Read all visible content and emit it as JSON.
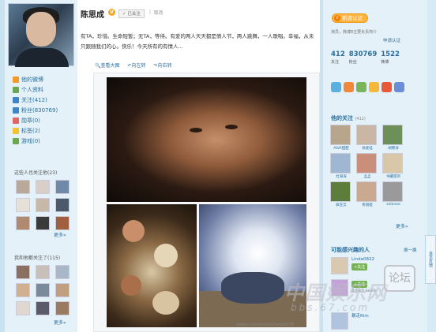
{
  "profile": {
    "name": "陈思成",
    "followed_label": "已关注",
    "separator": "|",
    "cancel_label": "取消"
  },
  "post": {
    "text": "有TA，珍惜。生命短暂；无TA，等待。有爱的两人天天都是情人节，两人跳舞，一人歌唱。幸福，从未只跟随我们的心。快乐！今天所有的有情人..."
  },
  "post_tools": [
    "查看大图",
    "向左转",
    "向右转"
  ],
  "photo_credit": "weibo.com/chensichong1078",
  "watermark": {
    "main": "中国娱乐网",
    "sub": "bbs.67.com",
    "box": "论坛"
  },
  "left_nav": [
    {
      "label": "他的微博",
      "icon": "home-icon",
      "color": "#f39a2b"
    },
    {
      "label": "个人资料",
      "icon": "profile-icon",
      "color": "#6aa84f"
    },
    {
      "label": "关注(412)",
      "icon": "follow-icon",
      "color": "#3d85c6"
    },
    {
      "label": "粉丝(830769)",
      "icon": "fans-icon",
      "color": "#3d85c6"
    },
    {
      "label": "勋章(0)",
      "icon": "medal-icon",
      "color": "#e06666"
    },
    {
      "label": "标签(2)",
      "icon": "tag-icon",
      "color": "#f1c232"
    },
    {
      "label": "游戏(0)",
      "icon": "game-icon",
      "color": "#6aa84f"
    }
  ],
  "left_sections": {
    "also_followed_title": "这些人也关注他(23)",
    "also_followed": [
      "",
      "",
      "",
      "",
      "",
      "",
      "",
      "",
      ""
    ],
    "also_followed_names": [
      "",
      "",
      "",
      "",
      "",
      "",
      "",
      "",
      ""
    ],
    "more": "更多»",
    "he_followed_title": "我和他都关注了(115)",
    "he_followed_names": [
      "",
      "",
      "",
      "",
      "",
      "",
      "",
      "",
      ""
    ],
    "more2": "更多»"
  },
  "right": {
    "verify_badge": "新浪认证",
    "domain_line": "演员，微博8主要负责简介",
    "apply_label": "申请认证",
    "stats": [
      {
        "num": "412",
        "label": "关注"
      },
      {
        "num": "830769",
        "label": "粉丝"
      },
      {
        "num": "1522",
        "label": "微博"
      }
    ],
    "following_title": "他的关注",
    "following_count": "(412)",
    "following": [
      {
        "name": "AIVA甜甜",
        "color": "#b7a58c"
      },
      {
        "name": "徐爱桂",
        "color": "#c9b6a4"
      },
      {
        "name": "胡锦涛",
        "color": "#6d8f5a"
      },
      {
        "name": "杜海涛",
        "color": "#9fb7d0"
      },
      {
        "name": "孟孟",
        "color": "#c98f7a"
      },
      {
        "name": "书藏密的",
        "color": "#d8c7a8"
      },
      {
        "name": "疯狂云",
        "color": "#5d7d3c"
      },
      {
        "name": "佟丽娅",
        "color": "#c9a98f"
      },
      {
        "name": "soloneo",
        "color": "#9a9a9a"
      }
    ],
    "more": "更多»",
    "may_know_title": "可能感兴趣的人",
    "change_label": "换一换",
    "suggestions": [
      {
        "name": "Linda0822",
        "action": "+关注",
        "desc": "",
        "color": "#d9c9b0"
      },
      {
        "name": "",
        "action": "+关注",
        "desc": "北京8万 Selina",
        "color": "#c4a1d8"
      },
      {
        "name": "暴走Rim",
        "action": "",
        "desc": "",
        "color": "#b0c4de"
      }
    ]
  },
  "feedback_label": "意见反馈"
}
